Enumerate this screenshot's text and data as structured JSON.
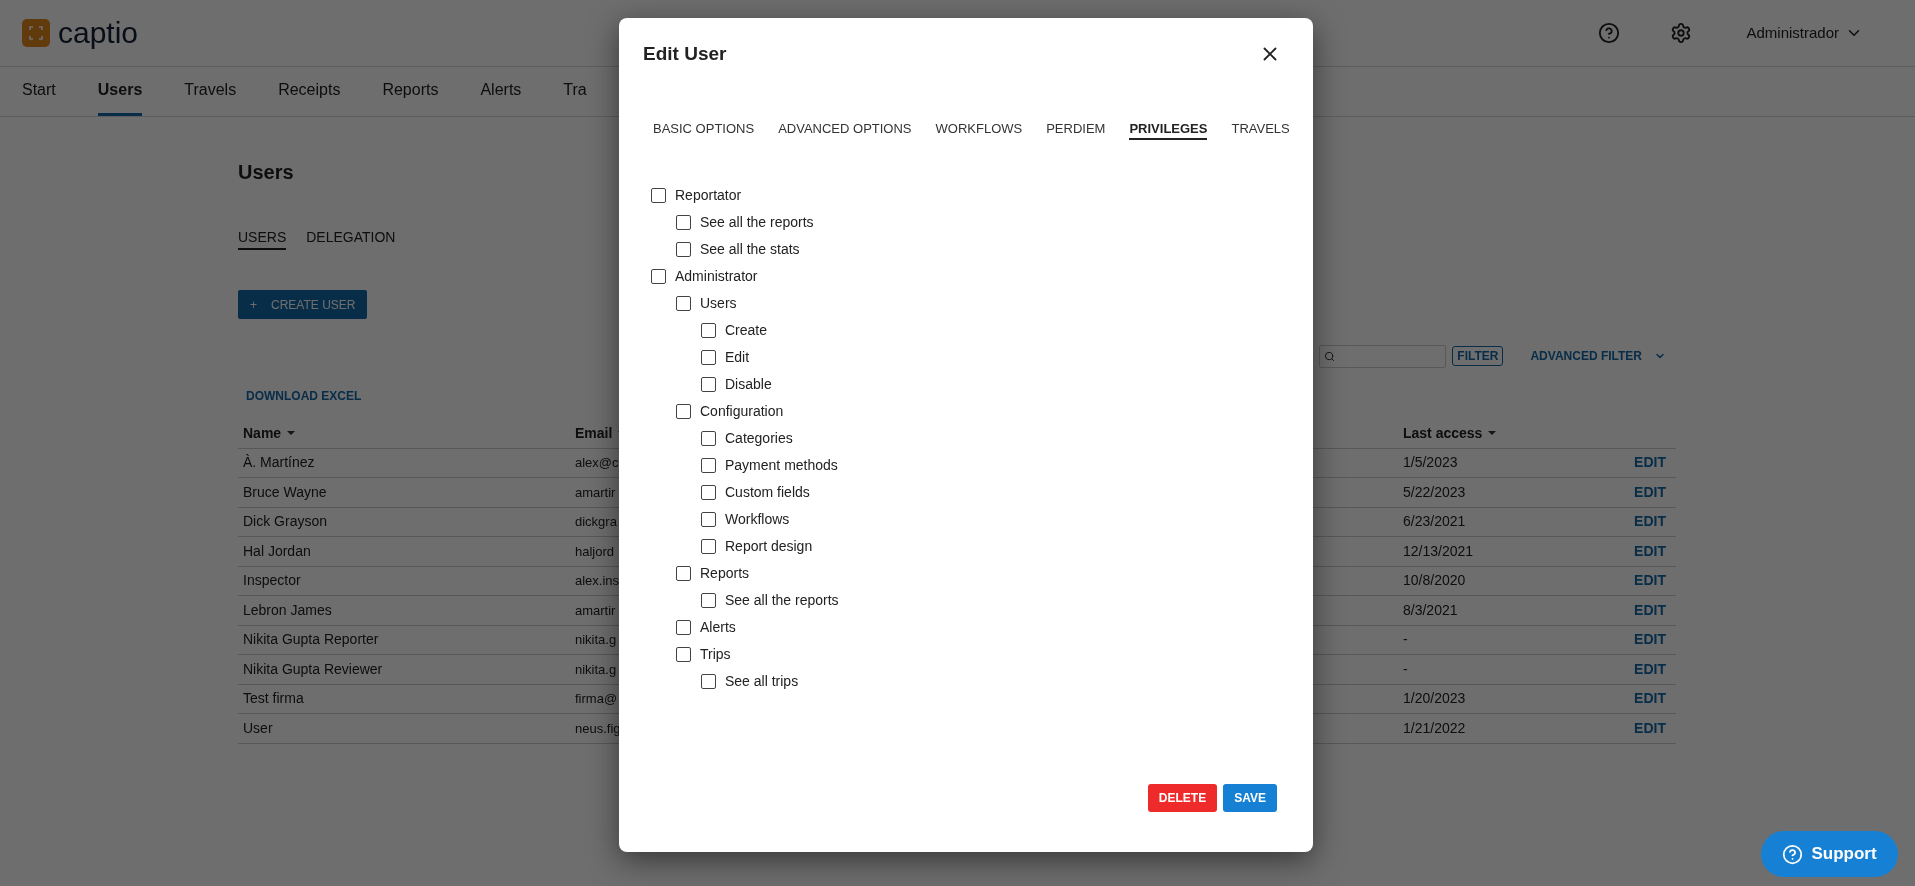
{
  "header": {
    "brand": "captio",
    "user_menu": "Administrador"
  },
  "nav": [
    {
      "label": "Start",
      "selected": false
    },
    {
      "label": "Users",
      "selected": true
    },
    {
      "label": "Travels",
      "selected": false
    },
    {
      "label": "Receipts",
      "selected": false
    },
    {
      "label": "Reports",
      "selected": false
    },
    {
      "label": "Alerts",
      "selected": false
    },
    {
      "label": "Tra",
      "selected": false
    }
  ],
  "page": {
    "title": "Users",
    "subtabs": [
      {
        "label": "USERS",
        "selected": true
      },
      {
        "label": "DELEGATION",
        "selected": false
      }
    ],
    "create_button": "CREATE USER",
    "create_icon": "+",
    "download": "DOWNLOAD EXCEL",
    "filter_button": "FILTER",
    "advanced_filter": "ADVANCED FILTER"
  },
  "table": {
    "columns": [
      "Name",
      "Email",
      "Last access"
    ],
    "rows": [
      {
        "name": "À. Martínez",
        "email": "alex@c",
        "last_access": "1/5/2023",
        "action": "EDIT"
      },
      {
        "name": "Bruce Wayne",
        "email": "amartir",
        "last_access": "5/22/2023",
        "action": "EDIT"
      },
      {
        "name": "Dick Grayson",
        "email": "dickgra",
        "last_access": "6/23/2021",
        "action": "EDIT"
      },
      {
        "name": "Hal Jordan",
        "email": "haljord",
        "last_access": "12/13/2021",
        "action": "EDIT"
      },
      {
        "name": "Inspector",
        "email": "alex.ins",
        "last_access": "10/8/2020",
        "action": "EDIT"
      },
      {
        "name": "Lebron James",
        "email": "amartir",
        "last_access": "8/3/2021",
        "action": "EDIT"
      },
      {
        "name": "Nikita Gupta Reporter",
        "email": "nikita.g",
        "last_access": "-",
        "action": "EDIT"
      },
      {
        "name": "Nikita Gupta Reviewer",
        "email": "nikita.g",
        "last_access": "-",
        "action": "EDIT"
      },
      {
        "name": "Test firma",
        "email": "firma@",
        "last_access": "1/20/2023",
        "action": "EDIT"
      },
      {
        "name": "User",
        "email": "neus.fig",
        "last_access": "1/21/2022",
        "action": "EDIT"
      }
    ]
  },
  "dialog": {
    "title": "Edit User",
    "tabs": [
      {
        "label": "BASIC OPTIONS",
        "selected": false
      },
      {
        "label": "ADVANCED OPTIONS",
        "selected": false
      },
      {
        "label": "WORKFLOWS",
        "selected": false
      },
      {
        "label": "PERDIEM",
        "selected": false
      },
      {
        "label": "PRIVILEGES",
        "selected": true
      },
      {
        "label": "TRAVELS",
        "selected": false
      }
    ],
    "privileges": [
      {
        "label": "Reportator",
        "checked": false,
        "children": [
          {
            "label": "See all the reports",
            "checked": false
          },
          {
            "label": "See all the stats",
            "checked": false
          }
        ]
      },
      {
        "label": "Administrator",
        "checked": false,
        "children": [
          {
            "label": "Users",
            "checked": false,
            "children": [
              {
                "label": "Create",
                "checked": false
              },
              {
                "label": "Edit",
                "checked": false
              },
              {
                "label": "Disable",
                "checked": false
              }
            ]
          },
          {
            "label": "Configuration",
            "checked": false,
            "children": [
              {
                "label": "Categories",
                "checked": false
              },
              {
                "label": "Payment methods",
                "checked": false
              },
              {
                "label": "Custom fields",
                "checked": false
              },
              {
                "label": "Workflows",
                "checked": false
              },
              {
                "label": "Report design",
                "checked": false
              }
            ]
          },
          {
            "label": "Reports",
            "checked": false,
            "children": [
              {
                "label": "See all the reports",
                "checked": false
              }
            ]
          },
          {
            "label": "Alerts",
            "checked": false
          },
          {
            "label": "Trips",
            "checked": false,
            "children": [
              {
                "label": "See all trips",
                "checked": false
              }
            ]
          }
        ]
      }
    ],
    "buttons": [
      {
        "label": "DELETE",
        "kind": "danger"
      },
      {
        "label": "SAVE",
        "kind": "primary"
      }
    ]
  },
  "support": "Support"
}
